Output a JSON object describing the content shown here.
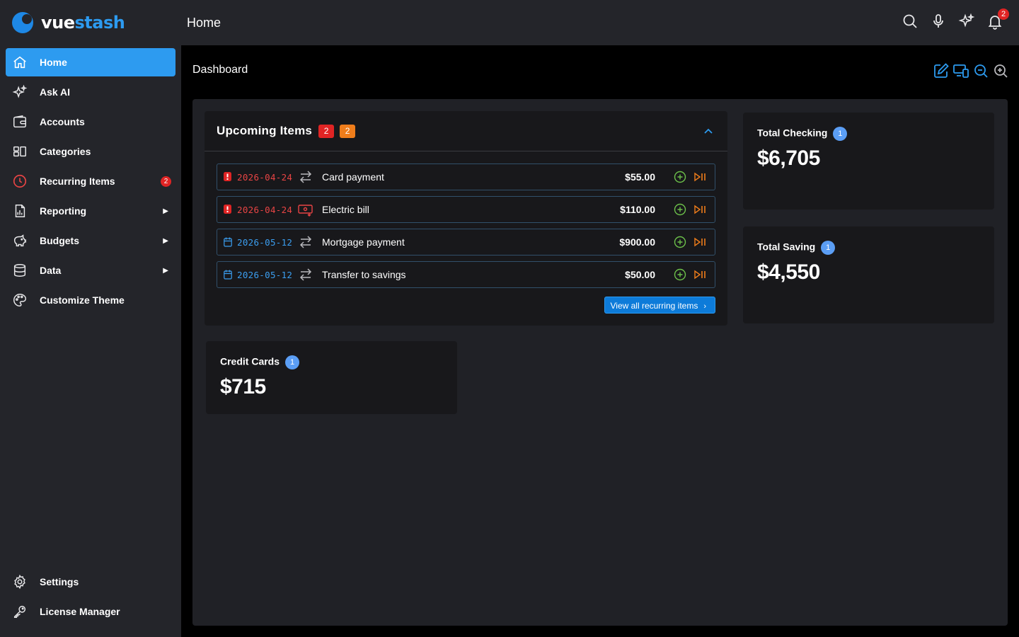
{
  "app": {
    "brand_part1": "vue",
    "brand_part2": "stash",
    "brand_color": "#2d9bf0"
  },
  "header": {
    "title": "Home",
    "notifications_count": "2",
    "icons": [
      "search-icon",
      "microphone-icon",
      "sparkles-icon",
      "bell-icon"
    ]
  },
  "sidebar": {
    "items": [
      {
        "label": "Home",
        "icon": "home-icon",
        "active": true
      },
      {
        "label": "Ask AI",
        "icon": "sparkles-icon"
      },
      {
        "label": "Accounts",
        "icon": "wallet-icon"
      },
      {
        "label": "Categories",
        "icon": "categories-icon"
      },
      {
        "label": "Recurring Items",
        "icon": "clock-icon",
        "badge": "2"
      },
      {
        "label": "Reporting",
        "icon": "report-icon",
        "has_submenu": true
      },
      {
        "label": "Budgets",
        "icon": "piggy-bank-icon",
        "has_submenu": true
      },
      {
        "label": "Data",
        "icon": "database-icon",
        "has_submenu": true
      },
      {
        "label": "Customize Theme",
        "icon": "palette-icon"
      }
    ],
    "bottom_items": [
      {
        "label": "Settings",
        "icon": "gear-icon"
      },
      {
        "label": "License Manager",
        "icon": "key-icon"
      }
    ],
    "submenu_arrow": "▶"
  },
  "dashboard": {
    "title": "Dashboard",
    "tools": [
      "edit-icon",
      "devices-icon",
      "zoom-out-icon",
      "zoom-in-icon"
    ]
  },
  "upcoming": {
    "title": "Upcoming Items",
    "badge_red": "2",
    "badge_orange": "2",
    "items": [
      {
        "date": "2026-04-24",
        "status": "overdue",
        "type": "transfer",
        "description": "Card payment",
        "amount": "$55.00"
      },
      {
        "date": "2026-04-24",
        "status": "overdue",
        "type": "bill",
        "description": "Electric bill",
        "amount": "$110.00"
      },
      {
        "date": "2026-05-12",
        "status": "scheduled",
        "type": "transfer",
        "description": "Mortgage payment",
        "amount": "$900.00"
      },
      {
        "date": "2026-05-12",
        "status": "scheduled",
        "type": "transfer",
        "description": "Transfer to savings",
        "amount": "$50.00"
      }
    ],
    "view_all_label": "View all recurring items",
    "view_all_chevron": "›"
  },
  "stats": {
    "checking": {
      "title": "Total Checking",
      "count": "1",
      "value": "$6,705"
    },
    "saving": {
      "title": "Total Saving",
      "count": "1",
      "value": "$4,550"
    },
    "credit": {
      "title": "Credit Cards",
      "count": "1",
      "value": "$715"
    }
  },
  "colors": {
    "overdue": "#e84444",
    "scheduled": "#3b9ef0",
    "add": "#6cc04a",
    "skip": "#ef7d1b"
  }
}
